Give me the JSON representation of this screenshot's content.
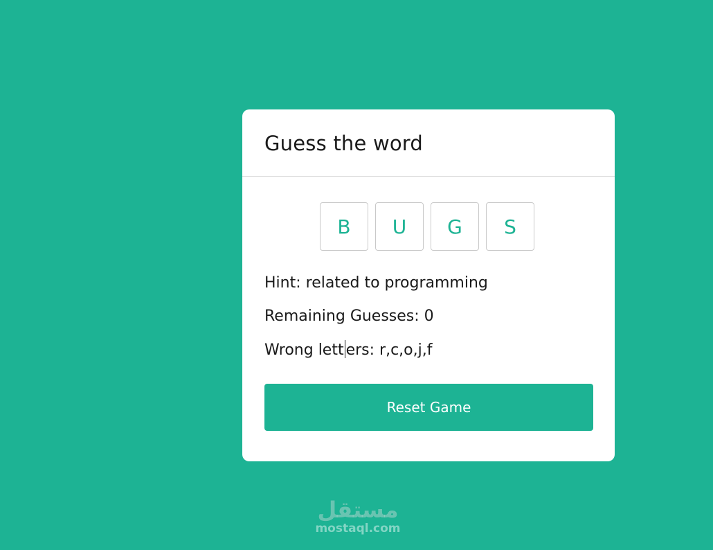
{
  "card": {
    "title": "Guess the word",
    "letters": [
      "B",
      "U",
      "G",
      "S"
    ],
    "hint": "Hint: related to programming",
    "remaining": "Remaining Guesses: 0",
    "wrong_before_caret": "Wrong lett",
    "wrong_after_caret": "ers: r,c,o,j,f",
    "reset_label": "Reset Game"
  },
  "watermark": {
    "logo_text": "مستقل",
    "url": "mostaql.com"
  },
  "colors": {
    "background": "#1db394",
    "accent": "#1db394",
    "card": "#ffffff"
  }
}
